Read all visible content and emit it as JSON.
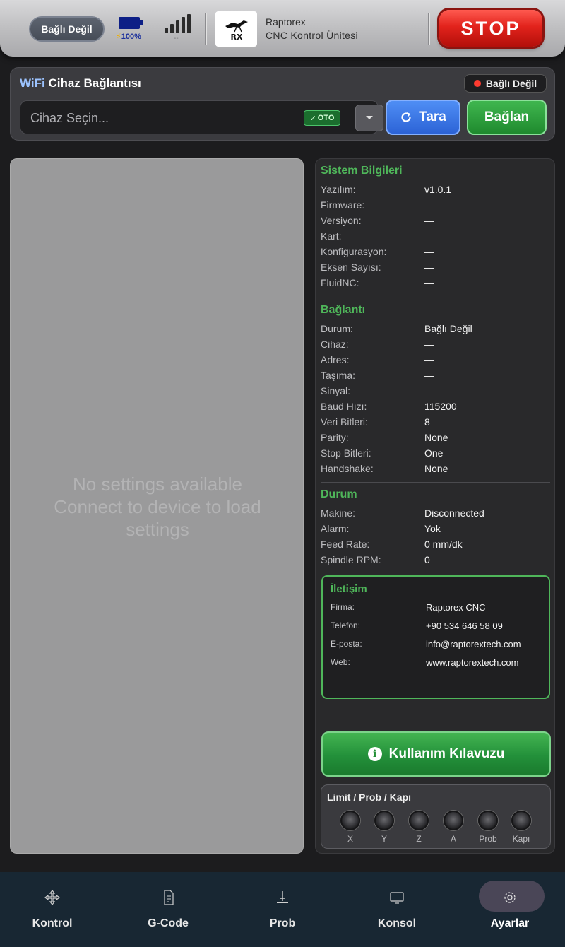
{
  "header": {
    "connection_status": "Bağlı Değil",
    "battery_text": "100%",
    "signal_subtext": "--",
    "brand_name": "Raptorex",
    "brand_subtitle": "CNC Kontrol Ünitesi",
    "logo_text": "RX",
    "stop_label": "STOP"
  },
  "wifi": {
    "title_prefix": "WiFi",
    "title": "Cihaz Bağlantısı",
    "status": "Bağlı Değil",
    "device_placeholder": "Cihaz Seçin...",
    "auto_badge": "OTO",
    "scan_label": "Tara",
    "connect_label": "Bağlan"
  },
  "settings": {
    "empty_line1": "No settings available",
    "empty_line2": "Connect to device to load",
    "empty_line3": "settings"
  },
  "system_info": {
    "title": "Sistem Bilgileri",
    "rows": [
      {
        "label": "Yazılım:",
        "value": "v1.0.1"
      },
      {
        "label": "Firmware:",
        "value": "—"
      },
      {
        "label": "Versiyon:",
        "value": "—"
      },
      {
        "label": "Kart:",
        "value": "—"
      },
      {
        "label": "Konfigurasyon:",
        "value": "—"
      },
      {
        "label": "Eksen Sayısı:",
        "value": "—"
      },
      {
        "label": "FluidNC:",
        "value": "—"
      }
    ]
  },
  "connection": {
    "title": "Bağlantı",
    "rows": [
      {
        "label": "Durum:",
        "value": "Bağlı Değil"
      },
      {
        "label": "Cihaz:",
        "value": "—"
      },
      {
        "label": "Adres:",
        "value": "—"
      },
      {
        "label": "Taşıma:",
        "value": "—"
      },
      {
        "label": "Sinyal:",
        "value": "—"
      },
      {
        "label": "Baud Hızı:",
        "value": "115200"
      },
      {
        "label": "Veri Bitleri:",
        "value": "8"
      },
      {
        "label": "Parity:",
        "value": "None"
      },
      {
        "label": "Stop Bitleri:",
        "value": "One"
      },
      {
        "label": "Handshake:",
        "value": "None"
      }
    ]
  },
  "status": {
    "title": "Durum",
    "rows": [
      {
        "label": "Makine:",
        "value": "Disconnected"
      },
      {
        "label": "Alarm:",
        "value": "Yok"
      },
      {
        "label": "Feed Rate:",
        "value": "0 mm/dk"
      },
      {
        "label": "Spindle RPM:",
        "value": "0"
      }
    ]
  },
  "contact": {
    "title": "İletişim",
    "rows": [
      {
        "label": "Firma:",
        "value": "Raptorex CNC"
      },
      {
        "label": "Telefon:",
        "value": "+90 534 646 58 09"
      },
      {
        "label": "E-posta:",
        "value": "info@raptorextech.com"
      },
      {
        "label": "Web:",
        "value": "www.raptorextech.com"
      }
    ]
  },
  "guide_button": "Kullanım Kılavuzu",
  "limits": {
    "title": "Limit / Prob / Kapı",
    "indicators": [
      "X",
      "Y",
      "Z",
      "A",
      "Prob",
      "Kapı"
    ]
  },
  "nav": {
    "items": [
      {
        "label": "Kontrol",
        "icon": "move-icon"
      },
      {
        "label": "G-Code",
        "icon": "gcode-file-icon"
      },
      {
        "label": "Prob",
        "icon": "probe-icon"
      },
      {
        "label": "Konsol",
        "icon": "console-icon"
      },
      {
        "label": "Ayarlar",
        "icon": "settings-gear-icon"
      }
    ],
    "active": "Ayarlar"
  },
  "colors": {
    "accent_green": "#4fb65a",
    "stop_red": "#e2231c",
    "scan_blue": "#2c63d6",
    "status_dot": "#ff3b30"
  }
}
